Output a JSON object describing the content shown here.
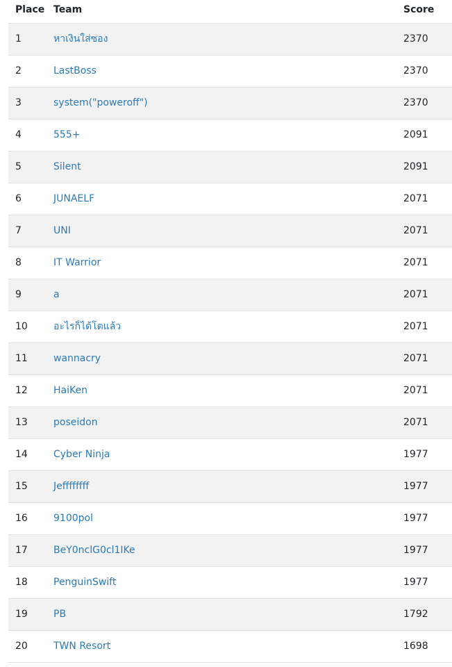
{
  "header": {
    "place": "Place",
    "team": "Team",
    "score": "Score"
  },
  "rows": [
    {
      "place": "1",
      "team": "หาเงินใส่ซอง",
      "score": "2370"
    },
    {
      "place": "2",
      "team": "LastBoss",
      "score": "2370"
    },
    {
      "place": "3",
      "team": "system(\"poweroff\")",
      "score": "2370"
    },
    {
      "place": "4",
      "team": "555+",
      "score": "2091"
    },
    {
      "place": "5",
      "team": "Silent",
      "score": "2091"
    },
    {
      "place": "6",
      "team": "JUNAELF",
      "score": "2071"
    },
    {
      "place": "7",
      "team": "UNI",
      "score": "2071"
    },
    {
      "place": "8",
      "team": "IT Warrior",
      "score": "2071"
    },
    {
      "place": "9",
      "team": "a",
      "score": "2071"
    },
    {
      "place": "10",
      "team": "อะไรก็ได้โตแล้ว",
      "score": "2071"
    },
    {
      "place": "11",
      "team": "wannacry",
      "score": "2071"
    },
    {
      "place": "12",
      "team": "HaiKen",
      "score": "2071"
    },
    {
      "place": "13",
      "team": "poseidon",
      "score": "2071"
    },
    {
      "place": "14",
      "team": "Cyber Ninja",
      "score": "1977"
    },
    {
      "place": "15",
      "team": "Jeffffffff",
      "score": "1977"
    },
    {
      "place": "16",
      "team": "9100pol",
      "score": "1977"
    },
    {
      "place": "17",
      "team": "BeY0nclG0cl1IKe",
      "score": "1977"
    },
    {
      "place": "18",
      "team": "PenguinSwift",
      "score": "1977"
    },
    {
      "place": "19",
      "team": "PB",
      "score": "1792"
    },
    {
      "place": "20",
      "team": "TWN Resort",
      "score": "1698"
    }
  ],
  "colors": {
    "link": "#2a7ab8",
    "stripe": "#f2f2f2",
    "border": "#dee2e6",
    "text": "#212529"
  }
}
